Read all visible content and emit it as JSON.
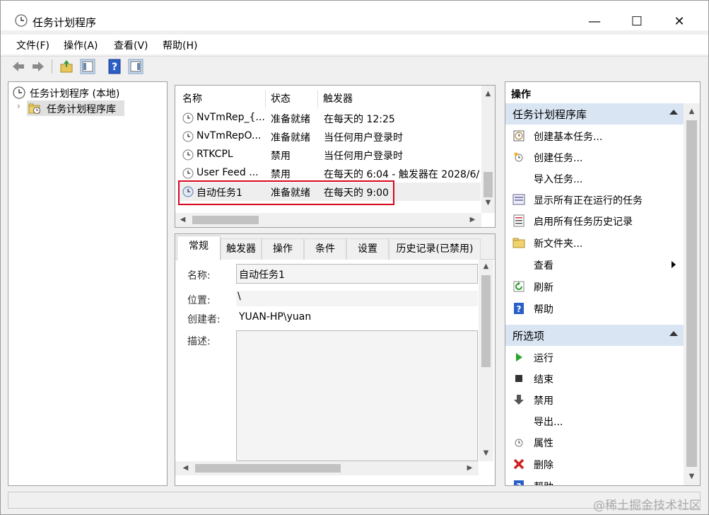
{
  "window": {
    "title": "任务计划程序"
  },
  "menu": [
    "文件(F)",
    "操作(A)",
    "查看(V)",
    "帮助(H)"
  ],
  "tree": {
    "root": "任务计划程序 (本地)",
    "child": "任务计划程序库"
  },
  "list": {
    "headers": [
      "名称",
      "状态",
      "触发器"
    ],
    "rows": [
      {
        "name": "NvTmRep_{...",
        "status": "准备就绪",
        "trigger": "在每天的 12:25"
      },
      {
        "name": "NvTmRepO...",
        "status": "准备就绪",
        "trigger": "当任何用户登录时"
      },
      {
        "name": "RTKCPL",
        "status": "禁用",
        "trigger": "当任何用户登录时"
      },
      {
        "name": "User Feed ...",
        "status": "禁用",
        "trigger": "在每天的 6:04 - 触发器在 2028/6/"
      },
      {
        "name": "自动任务1",
        "status": "准备就绪",
        "trigger": "在每天的 9:00"
      }
    ]
  },
  "tabs": [
    "常规",
    "触发器",
    "操作",
    "条件",
    "设置",
    "历史记录(已禁用)"
  ],
  "details": {
    "name_label": "名称:",
    "name_value": "自动任务1",
    "location_label": "位置:",
    "location_value": "\\",
    "author_label": "创建者:",
    "author_value": "YUAN-HP\\yuan",
    "desc_label": "描述:"
  },
  "actions": {
    "title": "操作",
    "group1": "任务计划程序库",
    "group1_items": [
      {
        "label": "创建基本任务...",
        "icon": "basic-task-icon"
      },
      {
        "label": "创建任务...",
        "icon": "create-task-icon"
      },
      {
        "label": "导入任务...",
        "icon": ""
      },
      {
        "label": "显示所有正在运行的任务",
        "icon": "running-tasks-icon"
      },
      {
        "label": "启用所有任务历史记录",
        "icon": "history-icon"
      },
      {
        "label": "新文件夹...",
        "icon": "folder-icon"
      },
      {
        "label": "查看",
        "icon": ""
      },
      {
        "label": "刷新",
        "icon": "refresh-icon"
      },
      {
        "label": "帮助",
        "icon": "help-icon"
      }
    ],
    "group2": "所选项",
    "group2_items": [
      {
        "label": "运行",
        "icon": "run-icon"
      },
      {
        "label": "结束",
        "icon": "stop-icon"
      },
      {
        "label": "禁用",
        "icon": "disable-icon"
      },
      {
        "label": "导出...",
        "icon": ""
      },
      {
        "label": "属性",
        "icon": "properties-icon"
      },
      {
        "label": "删除",
        "icon": "delete-icon"
      },
      {
        "label": "帮助",
        "icon": "help-icon"
      }
    ]
  },
  "watermark": "@稀土掘金技术社区",
  "colors": {
    "accent_group": "#dae5f3",
    "highlight_box": "#d7091c"
  }
}
